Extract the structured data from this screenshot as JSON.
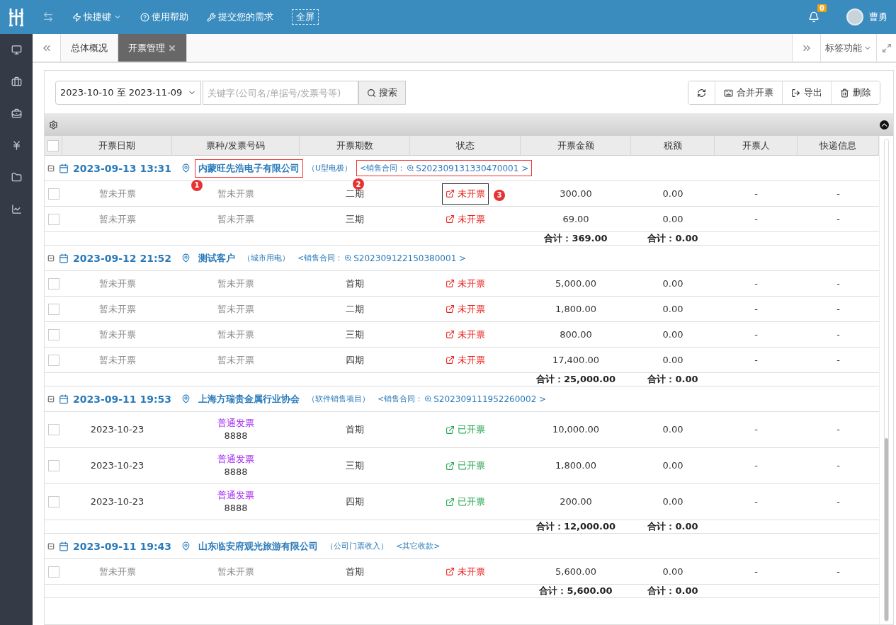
{
  "topbar": {
    "menu": [
      {
        "kind": "shortcut",
        "label": "快捷键"
      },
      {
        "kind": "help",
        "label": "使用帮助"
      },
      {
        "kind": "request",
        "label": "提交您的需求"
      },
      {
        "kind": "fullscreen",
        "label": "全屏"
      }
    ],
    "badge": "0",
    "user": "曹勇"
  },
  "sidebar": {
    "items": [
      {
        "kind": "monitor"
      },
      {
        "kind": "case"
      },
      {
        "kind": "toolbox"
      },
      {
        "kind": "yen"
      },
      {
        "kind": "folder"
      },
      {
        "kind": "chart"
      }
    ]
  },
  "tabs": [
    {
      "label": "总体概况",
      "selected": false,
      "closable": false
    },
    {
      "label": "开票管理",
      "selected": true,
      "closable": true
    }
  ],
  "tab_menu": "标签功能",
  "filter": {
    "date_range": "2023-10-10 至 2023-11-09",
    "placeholder": "关键字(公司名/单据号/发票号等)",
    "search": "搜索"
  },
  "actions": [
    {
      "kind": "refresh"
    },
    {
      "kind": "merge",
      "label": "合并开票"
    },
    {
      "kind": "export",
      "label": "导出"
    },
    {
      "kind": "delete",
      "label": "删除"
    }
  ],
  "table": {
    "columns": [
      "开票日期",
      "票种/发票号码",
      "开票期数",
      "状态",
      "开票金额",
      "税额",
      "开票人",
      "快递信息"
    ],
    "all_checked": false,
    "groups": [
      {
        "datetime": "2023-09-13 13:31",
        "customer": "内蒙旺先浩电子有限公司",
        "customer_mark": "1",
        "project": "（U型电极）",
        "contract_label": "<销售合同：",
        "contract_no": "S202309131330470001 >",
        "contract_mark": "2",
        "rows": [
          {
            "kind": "pending",
            "checked": false,
            "date": "暂未开票",
            "type": "暂未开票",
            "period": "二期",
            "status": "未开票",
            "status_mark": "3",
            "amount": "300.00",
            "tax": "0.00",
            "issuer": "-",
            "express": "-"
          },
          {
            "kind": "pending",
            "checked": false,
            "date": "暂未开票",
            "type": "暂未开票",
            "period": "三期",
            "status": "未开票",
            "amount": "69.00",
            "tax": "0.00",
            "issuer": "-",
            "express": "-"
          }
        ],
        "total_amount": "合计：369.00",
        "total_tax": "合计：0.00"
      },
      {
        "datetime": "2023-09-12 21:52",
        "customer": "测试客户",
        "project": "（城市用电）",
        "contract_label": "<销售合同：",
        "contract_no": "S202309122150380001 >",
        "rows": [
          {
            "kind": "pending",
            "checked": false,
            "date": "暂未开票",
            "type": "暂未开票",
            "period": "首期",
            "status": "未开票",
            "amount": "5,000.00",
            "tax": "0.00",
            "issuer": "-",
            "express": "-"
          },
          {
            "kind": "pending",
            "checked": false,
            "date": "暂未开票",
            "type": "暂未开票",
            "period": "二期",
            "status": "未开票",
            "amount": "1,800.00",
            "tax": "0.00",
            "issuer": "-",
            "express": "-"
          },
          {
            "kind": "pending",
            "checked": false,
            "date": "暂未开票",
            "type": "暂未开票",
            "period": "三期",
            "status": "未开票",
            "amount": "800.00",
            "tax": "0.00",
            "issuer": "-",
            "express": "-"
          },
          {
            "kind": "pending",
            "checked": false,
            "date": "暂未开票",
            "type": "暂未开票",
            "period": "四期",
            "status": "未开票",
            "amount": "17,400.00",
            "tax": "0.00",
            "issuer": "-",
            "express": "-"
          }
        ],
        "total_amount": "合计：25,000.00",
        "total_tax": "合计：0.00"
      },
      {
        "datetime": "2023-09-11 19:53",
        "customer": "上海方瑞贵金属行业协会",
        "project": "（软件销售项目）",
        "contract_label": "<销售合同：",
        "contract_no": "S202309111952260002 >",
        "rows": [
          {
            "kind": "issued",
            "checked": false,
            "date": "2023-10-23",
            "type": "普通发票",
            "number": "8888",
            "period": "首期",
            "status": "已开票",
            "amount": "10,000.00",
            "tax": "0.00",
            "issuer": "-",
            "express": "-"
          },
          {
            "kind": "issued",
            "checked": false,
            "date": "2023-10-23",
            "type": "普通发票",
            "number": "8888",
            "period": "三期",
            "status": "已开票",
            "amount": "1,800.00",
            "tax": "0.00",
            "issuer": "-",
            "express": "-"
          },
          {
            "kind": "issued",
            "checked": false,
            "date": "2023-10-23",
            "type": "普通发票",
            "number": "8888",
            "period": "四期",
            "status": "已开票",
            "amount": "200.00",
            "tax": "0.00",
            "issuer": "-",
            "express": "-"
          }
        ],
        "total_amount": "合计：12,000.00",
        "total_tax": "合计：0.00"
      },
      {
        "datetime": "2023-09-11 19:43",
        "customer": "山东临安府观光旅游有限公司",
        "project": "（公司门票收入）",
        "contract_label": "<其它收款>",
        "rows": [
          {
            "kind": "pending",
            "checked": false,
            "date": "暂未开票",
            "type": "暂未开票",
            "period": "首期",
            "status": "未开票",
            "amount": "5,600.00",
            "tax": "0.00",
            "issuer": "-",
            "express": "-"
          }
        ],
        "total_amount": "合计：5,600.00",
        "total_tax": "合计：0.00"
      }
    ]
  }
}
